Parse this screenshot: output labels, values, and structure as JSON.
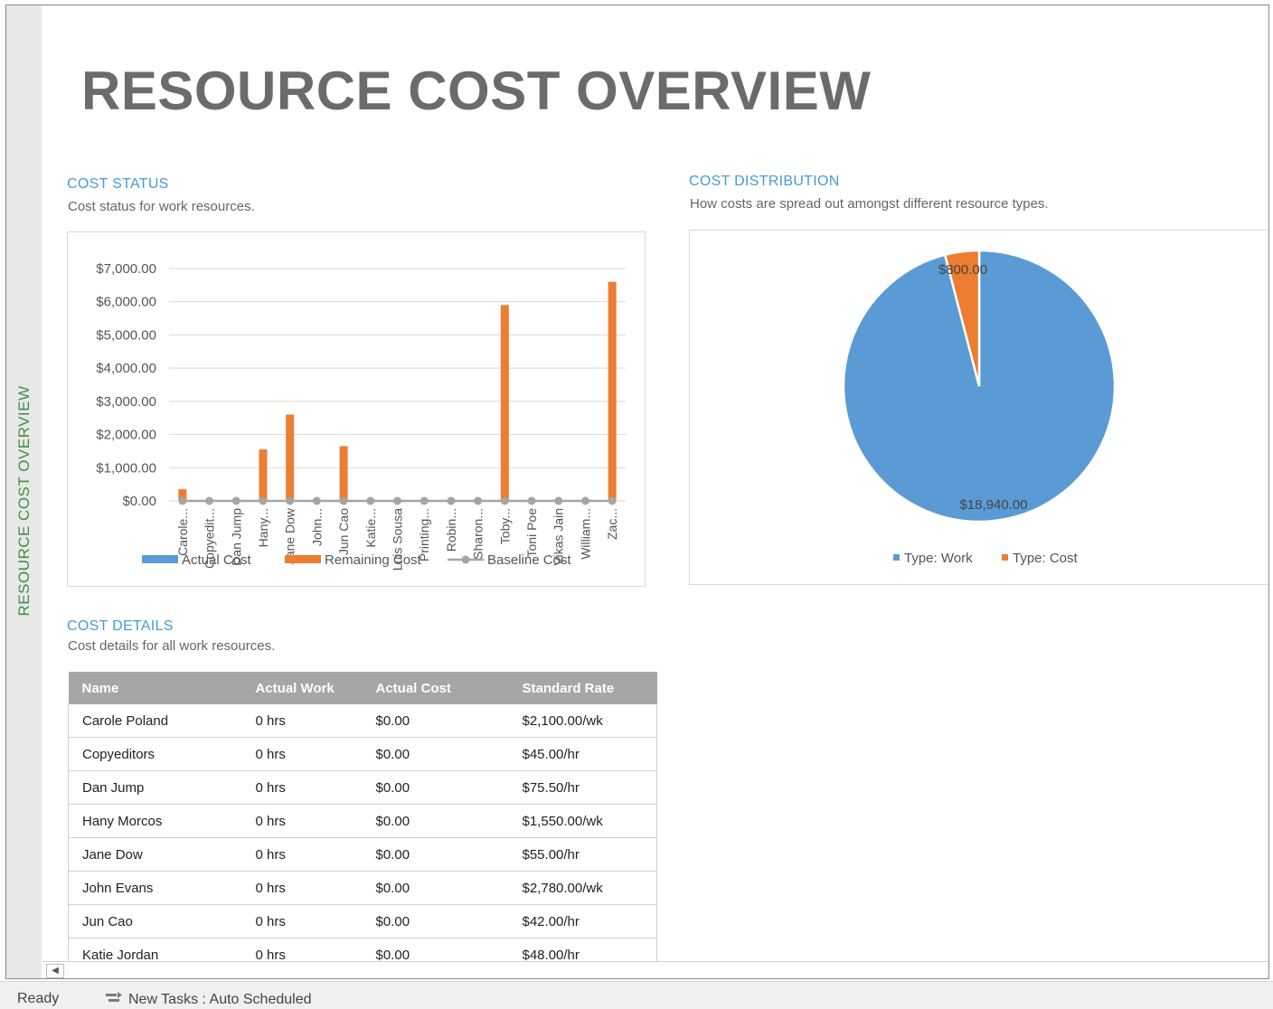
{
  "sidebar": {
    "label": "RESOURCE COST OVERVIEW"
  },
  "page": {
    "title": "RESOURCE COST OVERVIEW"
  },
  "cost_status": {
    "title": "COST STATUS",
    "subtitle": "Cost status for work resources."
  },
  "cost_distribution": {
    "title": "COST DISTRIBUTION",
    "subtitle": "How costs are spread out amongst different resource types."
  },
  "cost_details": {
    "title": "COST DETAILS",
    "subtitle": "Cost details for all work resources.",
    "columns": [
      "Name",
      "Actual Work",
      "Actual Cost",
      "Standard Rate"
    ],
    "rows": [
      [
        "Carole Poland",
        "0 hrs",
        "$0.00",
        "$2,100.00/wk"
      ],
      [
        "Copyeditors",
        "0 hrs",
        "$0.00",
        "$45.00/hr"
      ],
      [
        "Dan Jump",
        "0 hrs",
        "$0.00",
        "$75.50/hr"
      ],
      [
        "Hany Morcos",
        "0 hrs",
        "$0.00",
        "$1,550.00/wk"
      ],
      [
        "Jane Dow",
        "0 hrs",
        "$0.00",
        "$55.00/hr"
      ],
      [
        "John Evans",
        "0 hrs",
        "$0.00",
        "$2,780.00/wk"
      ],
      [
        "Jun Cao",
        "0 hrs",
        "$0.00",
        "$42.00/hr"
      ],
      [
        "Katie Jordan",
        "0 hrs",
        "$0.00",
        "$48.00/hr"
      ]
    ]
  },
  "status_bar": {
    "ready": "Ready",
    "new_tasks": "New Tasks : Auto Scheduled"
  },
  "colors": {
    "actual": "#5b9bd5",
    "remaining": "#ed7d31",
    "baseline": "#a5a5a5",
    "title_gray": "#6b6b6b",
    "section_blue": "#4a9ad4",
    "sidebar_green": "#3f8f3f"
  },
  "chart_data": [
    {
      "type": "bar",
      "categories": [
        "Carole...",
        "Copyedit...",
        "Dan Jump",
        "Hany...",
        "Jane Dow",
        "John...",
        "Jun Cao",
        "Katie...",
        "Luis Sousa",
        "Printing...",
        "Robin...",
        "Sharon...",
        "Toby...",
        "Toni Poe",
        "Vikas Jain",
        "William...",
        "Zac..."
      ],
      "series": [
        {
          "name": "Actual Cost",
          "values": [
            0,
            0,
            0,
            0,
            0,
            0,
            0,
            0,
            0,
            0,
            0,
            0,
            0,
            0,
            0,
            0,
            0
          ]
        },
        {
          "name": "Remaining Cost",
          "values": [
            350,
            0,
            0,
            1550,
            2600,
            0,
            1650,
            0,
            0,
            0,
            0,
            0,
            5900,
            0,
            0,
            0,
            6600
          ]
        },
        {
          "name": "Baseline Cost",
          "values": [
            0,
            0,
            0,
            0,
            0,
            0,
            0,
            0,
            0,
            0,
            0,
            0,
            0,
            0,
            0,
            0,
            0
          ]
        }
      ],
      "yticks": [
        "$0.00",
        "$1,000.00",
        "$2,000.00",
        "$3,000.00",
        "$4,000.00",
        "$5,000.00",
        "$6,000.00",
        "$7,000.00"
      ],
      "ylim": [
        0,
        7000
      ],
      "grid": true,
      "legend": "bottom"
    },
    {
      "type": "pie",
      "slices": [
        {
          "name": "Type: Work",
          "value": 18940,
          "label": "$18,940.00"
        },
        {
          "name": "Type: Cost",
          "value": 800,
          "label": "$800.00"
        }
      ],
      "legend": "bottom"
    }
  ]
}
